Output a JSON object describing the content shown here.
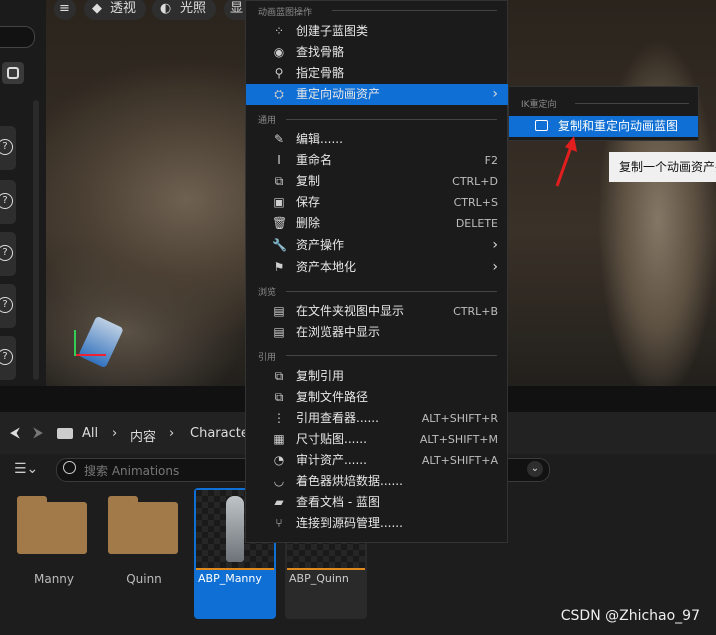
{
  "viewport_toolbar": {
    "perspective_label": "透视",
    "lighting_label": "光照",
    "show_label": "显示"
  },
  "context_menu": {
    "section_anim_bp": "动画蓝图操作",
    "create_child": "创建子蓝图类",
    "find_skeleton": "查找骨骼",
    "assign_skeleton": "指定骨骼",
    "retarget_anim": "重定向动画资产",
    "section_common": "通用",
    "edit": "编辑......",
    "rename": "重命名",
    "rename_shortcut": "F2",
    "duplicate": "复制",
    "duplicate_shortcut": "CTRL+D",
    "save": "保存",
    "save_shortcut": "CTRL+S",
    "delete": "删除",
    "delete_shortcut": "DELETE",
    "asset_actions": "资产操作",
    "asset_localization": "资产本地化",
    "section_browse": "浏览",
    "show_in_folder": "在文件夹视图中显示",
    "show_in_folder_shortcut": "CTRL+B",
    "show_in_browser": "在浏览器中显示",
    "section_references": "引用",
    "copy_reference": "复制引用",
    "copy_file_path": "复制文件路径",
    "reference_viewer": "引用查看器......",
    "reference_viewer_shortcut": "ALT+SHIFT+R",
    "size_map": "尺寸贴图......",
    "size_map_shortcut": "ALT+SHIFT+M",
    "audit_assets": "审计资产......",
    "audit_assets_shortcut": "ALT+SHIFT+A",
    "shader_cook": "着色器烘焙数据......",
    "view_docs": "查看文档 - 蓝图",
    "connect_source_control": "连接到源码管理......"
  },
  "submenu": {
    "section": "IK重定向",
    "duplicate_retarget": "复制和重定向动画蓝图"
  },
  "tooltip": "复制一个动画资产并",
  "content_browser": {
    "crumb_all": "All",
    "crumb_content": "内容",
    "crumb_characters": "Characters",
    "search_placeholder": "搜索 Animations",
    "folders": [
      "Manny",
      "Quinn"
    ],
    "assets": [
      "ABP_Manny",
      "ABP_Quinn"
    ]
  },
  "watermark": "CSDN @Zhichao_97",
  "colors": {
    "accent": "#0f6fd4",
    "menu_bg": "#1b1b1b",
    "folder": "#a27a4a",
    "asset_stripe": "#e08a1e"
  }
}
